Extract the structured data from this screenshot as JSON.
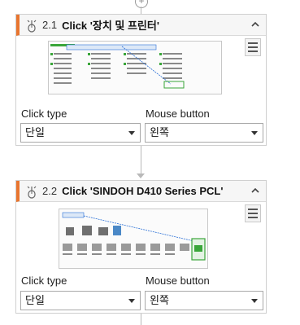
{
  "steps": [
    {
      "number": "2.1",
      "title": "Click '장치 및 프린터'",
      "click_type_label": "Click type",
      "click_type_value": "단일",
      "mouse_button_label": "Mouse button",
      "mouse_button_value": "왼쪽"
    },
    {
      "number": "2.2",
      "title": "Click 'SINDOH D410 Series PCL'",
      "click_type_label": "Click type",
      "click_type_value": "단일",
      "mouse_button_label": "Mouse button",
      "mouse_button_value": "왼쪽"
    }
  ],
  "add_step_symbol": "+",
  "colors": {
    "accent": "#e8752f",
    "border": "#cfcfcf",
    "highlight_green": "#3aa63a",
    "link_blue": "#2a6fd6"
  },
  "icons": [
    "mouse-click-icon",
    "chevron-up-icon",
    "menu-icon",
    "dropdown-caret-icon",
    "add-icon"
  ]
}
